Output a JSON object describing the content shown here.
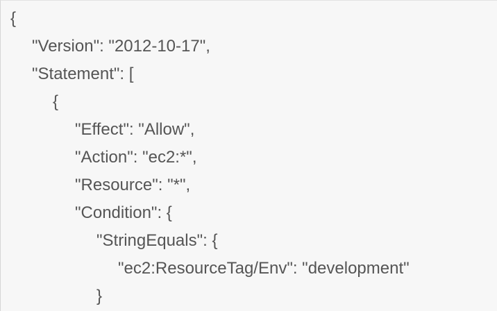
{
  "code": {
    "lines": [
      "{",
      "\"Version\": \"2012-10-17\",",
      "\"Statement\": [",
      "{",
      "\"Effect\": \"Allow\",",
      "\"Action\": \"ec2:*\",",
      "\"Resource\": \"*\",",
      "\"Condition\": {",
      "\"StringEquals\": {",
      "\"ec2:ResourceTag/Env\": \"development\"",
      "}"
    ]
  },
  "colors": {
    "panel_background": "#f7f7f7",
    "text": "#555555"
  }
}
